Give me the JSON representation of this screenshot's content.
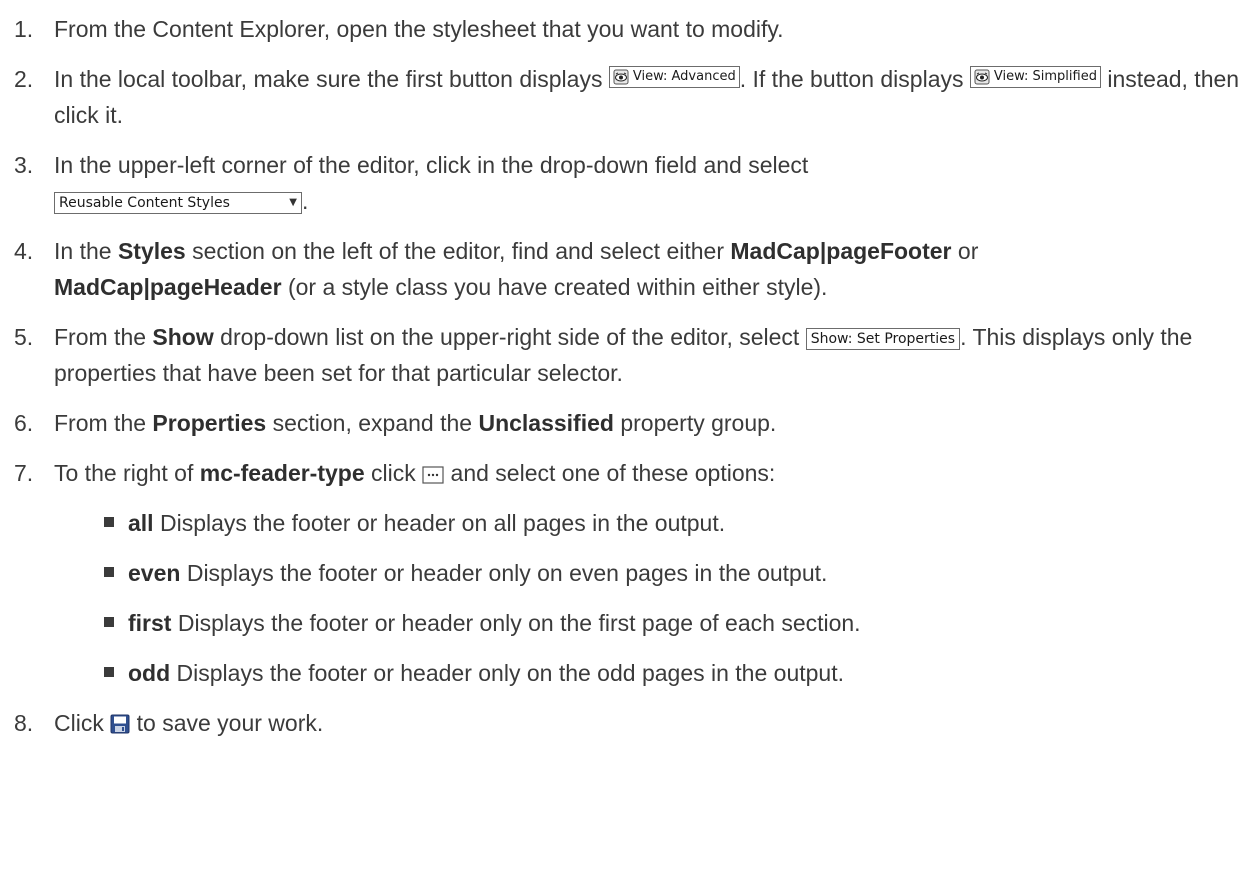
{
  "steps": [
    {
      "num": "1.",
      "text": "From the Content Explorer, open the stylesheet that you want to modify."
    },
    {
      "num": "2.",
      "t1": "In the local toolbar, make sure the first button displays",
      "chip1": "View: Advanced",
      "t2": ". If the button displays",
      "chip2": "View: Simplified",
      "t3": " instead, then click it."
    },
    {
      "num": "3.",
      "t1": "In the upper-left corner of the editor, click in the drop-down field and select",
      "select_value": "Reusable Content Styles",
      "t2": "."
    },
    {
      "num": "4.",
      "t1": "In the ",
      "b1": "Styles",
      "t2": " section on the left of the editor, find and select either ",
      "b2": "MadCap|pageFooter",
      "t3": " or ",
      "b3": "MadCap|pageHeader",
      "t4": " (or a style class you have created within either style)."
    },
    {
      "num": "5.",
      "t1": "From the ",
      "b1": "Show",
      "t2": " drop-down list on the upper-right side of the editor, select ",
      "chip": "Show: Set Properties",
      "t3": ". This displays only the properties that have been set for that particular selector."
    },
    {
      "num": "6.",
      "t1": "From the ",
      "b1": "Properties",
      "t2": " section, expand the ",
      "b2": "Unclassified",
      "t3": " property group."
    },
    {
      "num": "7.",
      "t1": "To the right of ",
      "b1": "mc-feader-type",
      "t2": " click ",
      "t3": " and select one of these options:",
      "options": [
        {
          "name": "all",
          "desc": " Displays the footer or header on all pages in the output."
        },
        {
          "name": "even",
          "desc": " Displays the footer or header only on even pages in the output."
        },
        {
          "name": "first",
          "desc": " Displays the footer or header only on the first page of each section."
        },
        {
          "name": "odd",
          "desc": " Displays the footer or header only on the odd pages in the output."
        }
      ]
    },
    {
      "num": "8.",
      "t1": "Click ",
      "t2": " to save your work."
    }
  ],
  "icons": {
    "view_icon": "eye-icon",
    "ellipsis_icon": "ellipsis-button-icon",
    "save_icon": "floppy-save-icon"
  },
  "colors": {
    "text": "#3b3b3b",
    "save_icon": "#2f4f8f"
  }
}
